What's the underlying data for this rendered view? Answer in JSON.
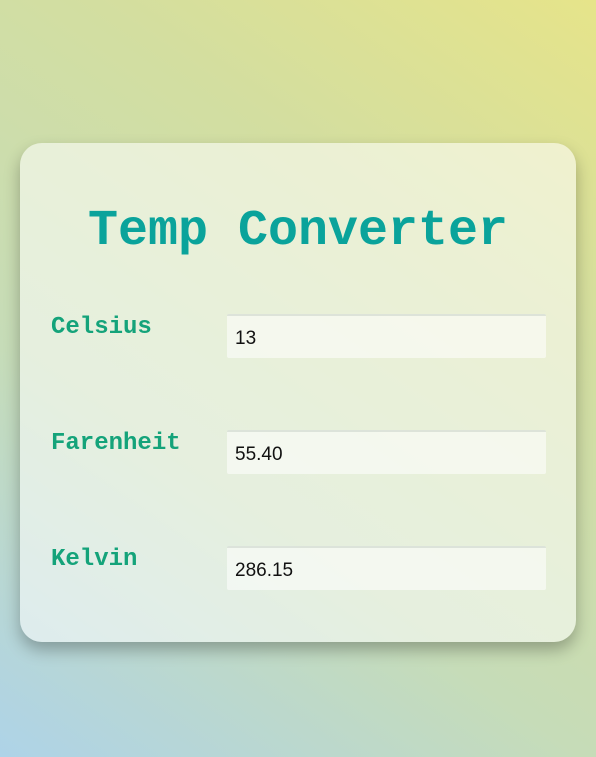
{
  "title": "Temp Converter",
  "fields": {
    "celsius": {
      "label": "Celsius",
      "value": "13"
    },
    "farenheit": {
      "label": "Farenheit",
      "value": "55.40"
    },
    "kelvin": {
      "label": "Kelvin",
      "value": "286.15"
    }
  },
  "colors": {
    "title": "#0aa39b",
    "labels": "#14a37a"
  }
}
